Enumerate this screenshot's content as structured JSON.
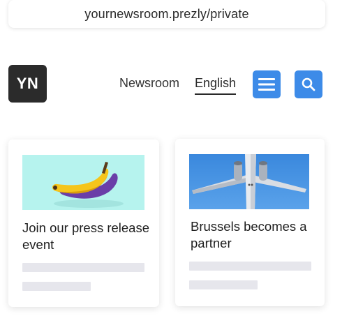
{
  "browser": {
    "url": "yournewsroom.prezly/private"
  },
  "header": {
    "logo_text": "YN",
    "nav": [
      {
        "label": "Newsroom"
      },
      {
        "label": "English",
        "active": true
      }
    ],
    "menu_icon": "hamburger-menu-icon",
    "search_icon": "search-icon",
    "accent_color": "#3d8be8"
  },
  "stories": [
    {
      "title": "Join our press release event",
      "image": "banana-on-mint-background"
    },
    {
      "title": "Brussels becomes a partner",
      "image": "airplane-in-blue-sky"
    }
  ]
}
